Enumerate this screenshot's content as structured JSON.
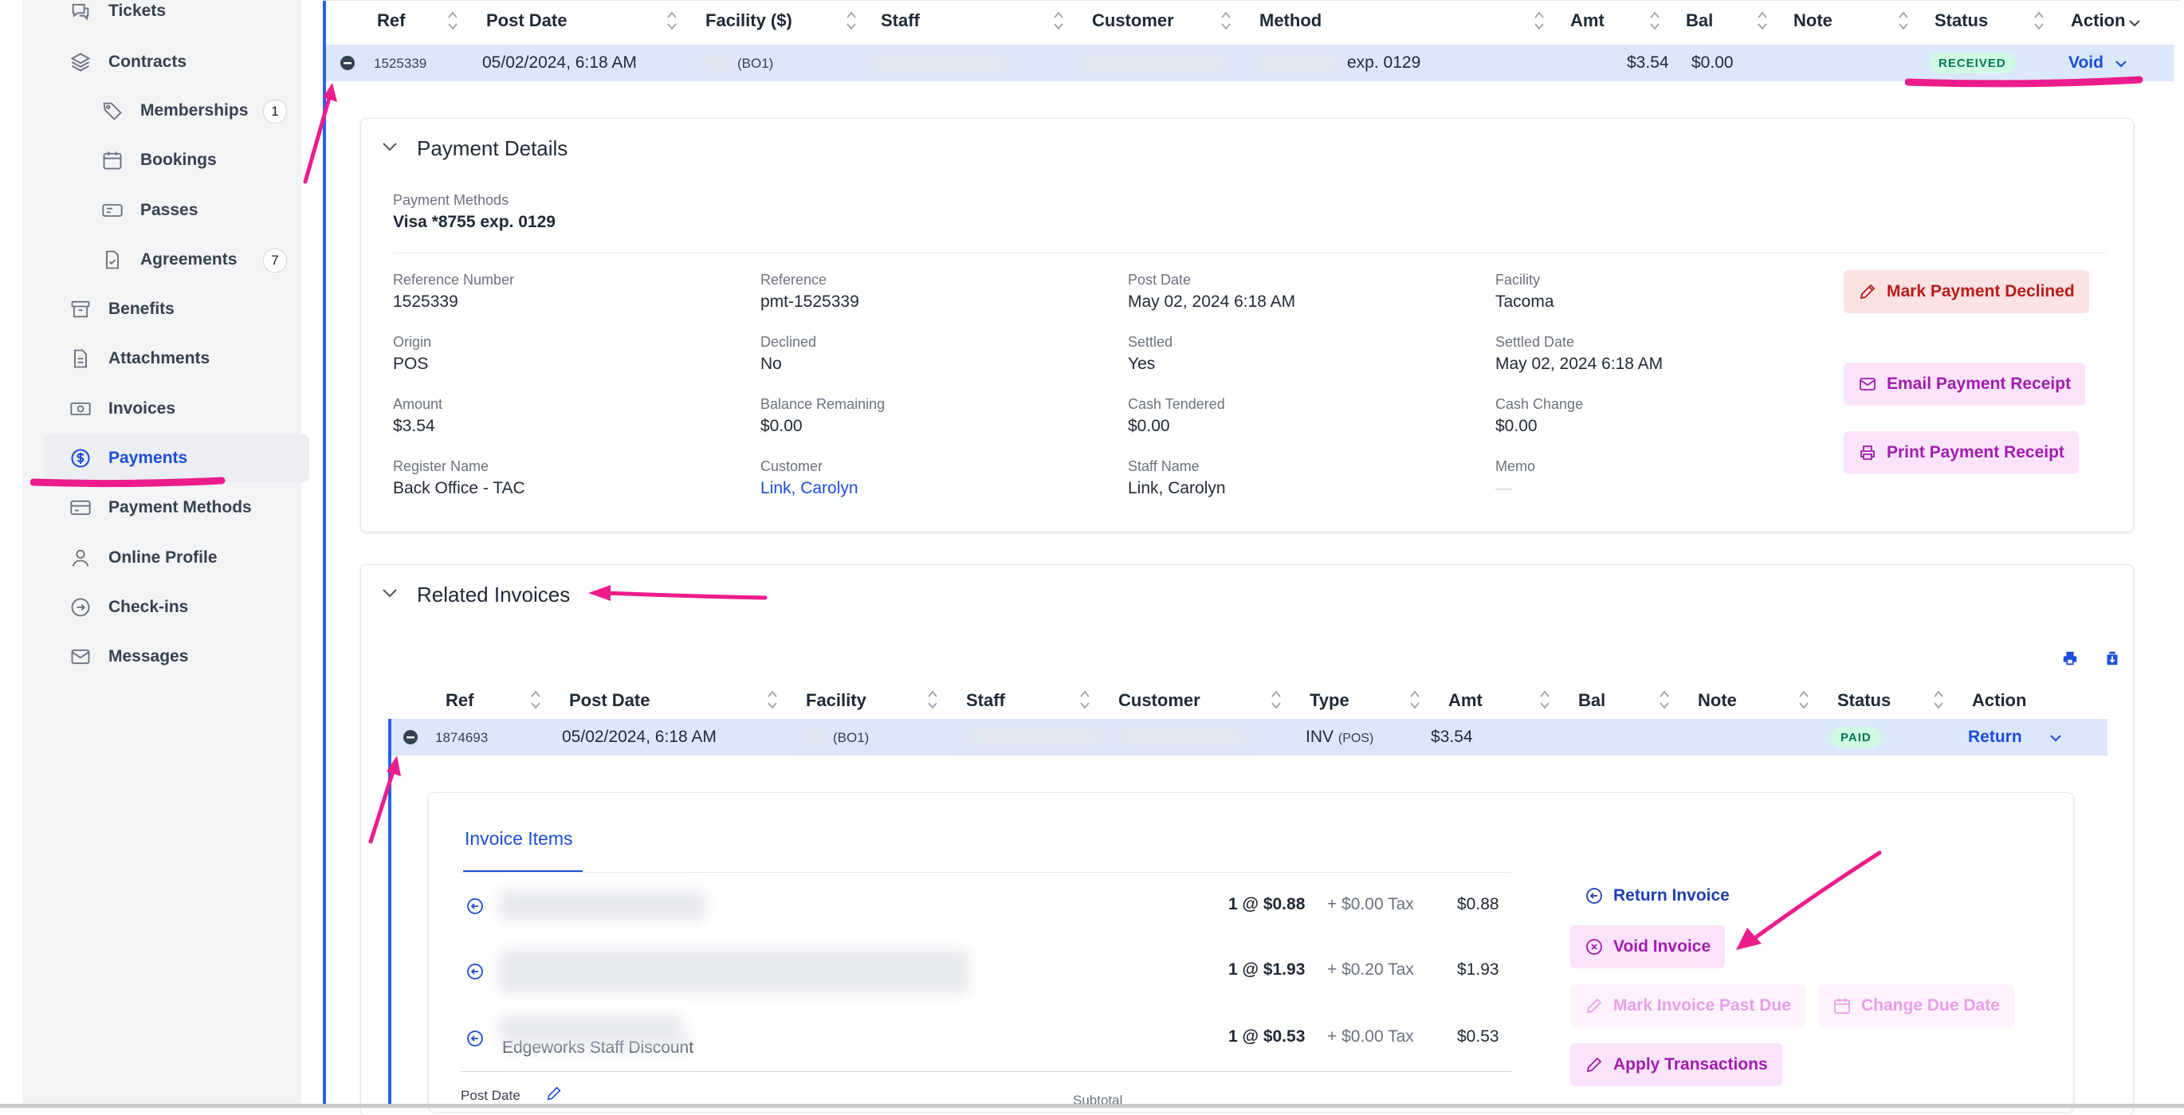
{
  "sidebar": {
    "items": [
      {
        "label": "Tickets",
        "icon": "chat-icon"
      },
      {
        "label": "Contracts",
        "icon": "layers-icon"
      },
      {
        "label": "Memberships",
        "icon": "tag-icon",
        "badge": "1"
      },
      {
        "label": "Bookings",
        "icon": "calendar-icon"
      },
      {
        "label": "Passes",
        "icon": "pass-icon"
      },
      {
        "label": "Agreements",
        "icon": "document-check-icon",
        "badge": "7"
      },
      {
        "label": "Benefits",
        "icon": "archive-icon"
      },
      {
        "label": "Attachments",
        "icon": "file-icon"
      },
      {
        "label": "Invoices",
        "icon": "cash-icon"
      },
      {
        "label": "Payments",
        "icon": "dollar-circle-icon",
        "active": true
      },
      {
        "label": "Payment Methods",
        "icon": "credit-card-icon"
      },
      {
        "label": "Online Profile",
        "icon": "user-icon"
      },
      {
        "label": "Check-ins",
        "icon": "arrow-circle-icon"
      },
      {
        "label": "Messages",
        "icon": "envelope-icon"
      }
    ]
  },
  "payments_table": {
    "headers": [
      "Ref",
      "Post Date",
      "Facility ($)",
      "Staff",
      "Customer",
      "Method",
      "Amt",
      "Bal",
      "Note",
      "Status",
      "Action"
    ],
    "row": {
      "ref": "1525339",
      "post_date": "05/02/2024, 6:18 AM",
      "facility": "(BO1)",
      "method": "exp. 0129",
      "amt": "$3.54",
      "bal": "$0.00",
      "status": "RECEIVED",
      "action": "Void"
    }
  },
  "payment_details": {
    "title": "Payment Details",
    "methods_label": "Payment Methods",
    "methods_value": "Visa *8755 exp. 0129",
    "fields": [
      {
        "label": "Reference Number",
        "value": "1525339"
      },
      {
        "label": "Reference",
        "value": "pmt-1525339"
      },
      {
        "label": "Post Date",
        "value": "May 02, 2024 6:18 AM"
      },
      {
        "label": "Facility",
        "value": "Tacoma"
      },
      {
        "label": "Origin",
        "value": "POS"
      },
      {
        "label": "Declined",
        "value": "No"
      },
      {
        "label": "Settled",
        "value": "Yes"
      },
      {
        "label": "Settled Date",
        "value": "May 02, 2024 6:18 AM"
      },
      {
        "label": "Amount",
        "value": "$3.54"
      },
      {
        "label": "Balance Remaining",
        "value": "$0.00"
      },
      {
        "label": "Cash Tendered",
        "value": "$0.00"
      },
      {
        "label": "Cash Change",
        "value": "$0.00"
      },
      {
        "label": "Register Name",
        "value": "Back Office - TAC"
      },
      {
        "label": "Customer",
        "value": "Link, Carolyn"
      },
      {
        "label": "Staff Name",
        "value": "Link, Carolyn"
      },
      {
        "label": "Memo",
        "value": "—"
      }
    ],
    "buttons": {
      "decline": "Mark Payment Declined",
      "email": "Email Payment Receipt",
      "print": "Print Payment Receipt"
    }
  },
  "related_invoices": {
    "title": "Related Invoices",
    "headers": [
      "Ref",
      "Post Date",
      "Facility",
      "Staff",
      "Customer",
      "Type",
      "Amt",
      "Bal",
      "Note",
      "Status",
      "Action"
    ],
    "row": {
      "ref": "1874693",
      "post_date": "05/02/2024, 6:18 AM",
      "facility": "(BO1)",
      "type": "INV",
      "type_sub": "(POS)",
      "amt": "$3.54",
      "status": "PAID",
      "action": "Return"
    }
  },
  "invoice_items": {
    "tab": "Invoice Items",
    "items": [
      {
        "qty": "1 @ $0.88",
        "tax": "+ $0.00 Tax",
        "total": "$0.88",
        "desc": ""
      },
      {
        "qty": "1 @ $1.93",
        "tax": "+ $0.20 Tax",
        "total": "$1.93",
        "desc": ""
      },
      {
        "qty": "1 @ $0.53",
        "tax": "+ $0.00 Tax",
        "total": "$0.53",
        "desc": "Edgeworks Staff Discount"
      }
    ],
    "footer_label": "Post Date",
    "subtotal_label": "Subtotal",
    "actions": {
      "return": "Return Invoice",
      "void": "Void Invoice",
      "past_due": "Mark Invoice Past Due",
      "due_date": "Change Due Date",
      "apply": "Apply Transactions"
    }
  },
  "colors": {
    "accent": "#1d4ed8",
    "annotation": "#ec1c8c",
    "row_highlight": "#dbe7fb"
  }
}
